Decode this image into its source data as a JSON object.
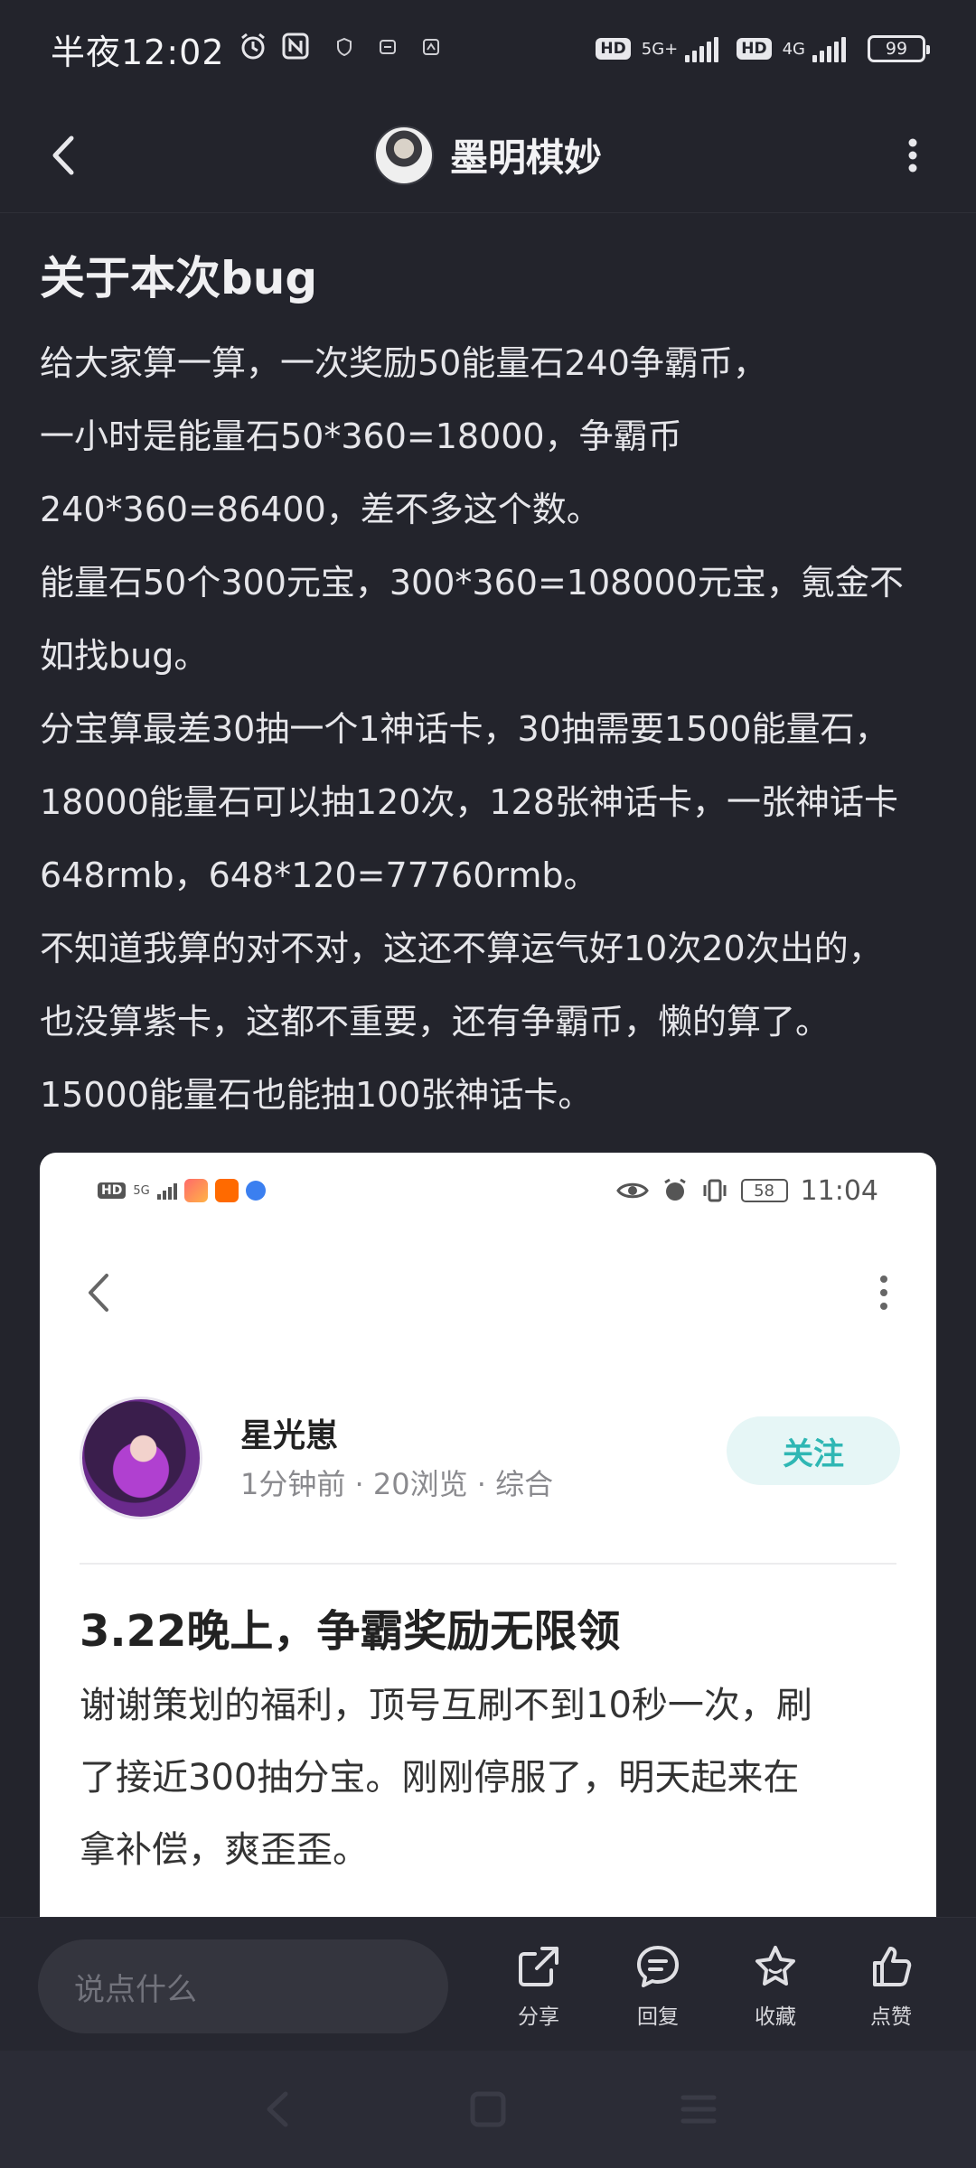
{
  "status_bar": {
    "time": "半夜12:02",
    "net1": "5G+",
    "net2": "4G",
    "hd1": "HD",
    "hd2": "HD",
    "battery": "99"
  },
  "header": {
    "username": "墨明棋妙"
  },
  "article": {
    "title": "关于本次bug",
    "lines": [
      "给大家算一算，一次奖励50能量石240争霸币，",
      "一小时是能量石50*360=18000，争霸币",
      "240*360=86400，差不多这个数。",
      "能量石50个300元宝，300*360=108000元宝，氪金不",
      "如找bug。",
      "分宝算最差30抽一个1神话卡，30抽需要1500能量石，",
      "18000能量石可以抽120次，128张神话卡，一张神话卡",
      "648rmb，648*120=77760rmb。",
      "不知道我算的对不对，这还不算运气好10次20次出的，",
      "也没算紫卡，这都不重要，还有争霸币，懒的算了。",
      "15000能量石也能抽100张神话卡。"
    ]
  },
  "embedded": {
    "status_hd": "HD",
    "status_net": "5G",
    "battery": "58",
    "time": "11:04",
    "author_name": "星光崽",
    "meta": "1分钟前 · 20浏览 · 综合",
    "follow_label": "关注",
    "post_title": "3.22晚上，争霸奖励无限领",
    "body_lines": [
      "谢谢策划的福利，顶号互刷不到10秒一次，刷",
      "了接近300抽分宝。刚刚停服了，明天起来在",
      "拿补偿，爽歪歪。"
    ]
  },
  "bottom_bar": {
    "input_placeholder": "说点什么",
    "share_label": "分享",
    "reply_label": "回复",
    "favorite_label": "收藏",
    "like_label": "点赞"
  },
  "colors": {
    "background": "#23242c",
    "accent_follow": "#2fb7b4"
  }
}
